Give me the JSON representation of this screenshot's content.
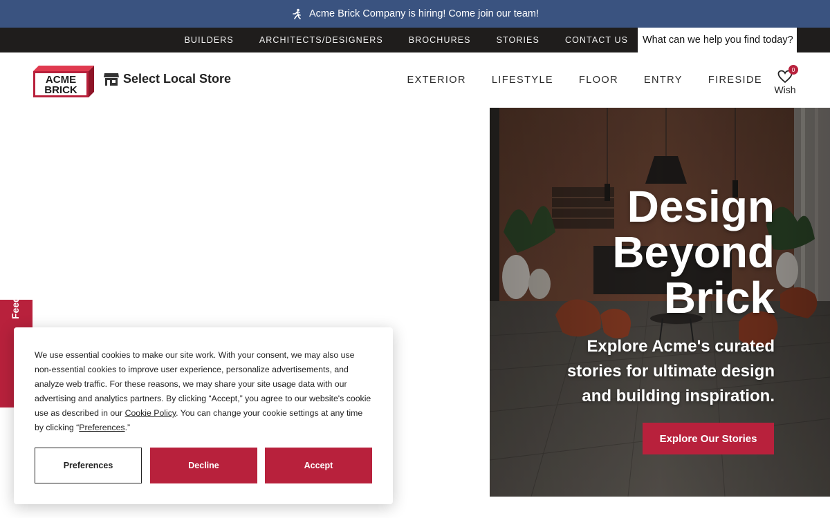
{
  "announcement": {
    "text": "Acme Brick Company is hiring! Come join our team!",
    "icon": "running-person-icon"
  },
  "utility_nav": {
    "items": [
      "BUILDERS",
      "ARCHITECTS/DESIGNERS",
      "BROCHURES",
      "STORIES",
      "CONTACT US"
    ],
    "search_placeholder": "What can we help you find today?"
  },
  "header": {
    "logo_text": [
      "ACME",
      "BRICK"
    ],
    "store_label": "Select Local Store",
    "store_icon": "storefront-icon",
    "nav": [
      "EXTERIOR",
      "LIFESTYLE",
      "FLOOR",
      "ENTRY",
      "FIRESIDE"
    ],
    "wish": {
      "label": "Wish",
      "count": "0",
      "icon": "heart-icon"
    }
  },
  "hero": {
    "title_lines": [
      "Design",
      "Beyond",
      "Brick"
    ],
    "subtitle_lines": [
      "Explore Acme's curated",
      "stories for ultimate design",
      "and building inspiration."
    ],
    "cta": "Explore Our Stories"
  },
  "feedback_tab": {
    "label": "Feedback"
  },
  "cookie_banner": {
    "text_before_link": "We use essential cookies to make our site work. With your consent, we may also use non-essential cookies to improve user experience, personalize advertisements, and analyze web traffic. For these reasons, we may share your site usage data with our advertising and analytics partners. By clicking “Accept,” you agree to our website's cookie use as described in our ",
    "policy_link": "Cookie Policy",
    "text_middle": ". You can change your cookie settings at any time by clicking “",
    "preferences_link": "Preferences",
    "text_end": ".”",
    "buttons": {
      "preferences": "Preferences",
      "decline": "Decline",
      "accept": "Accept"
    }
  },
  "colors": {
    "brand_red": "#b8213c",
    "announce_blue": "#3a5380",
    "utility_black": "#1f1d1c"
  }
}
